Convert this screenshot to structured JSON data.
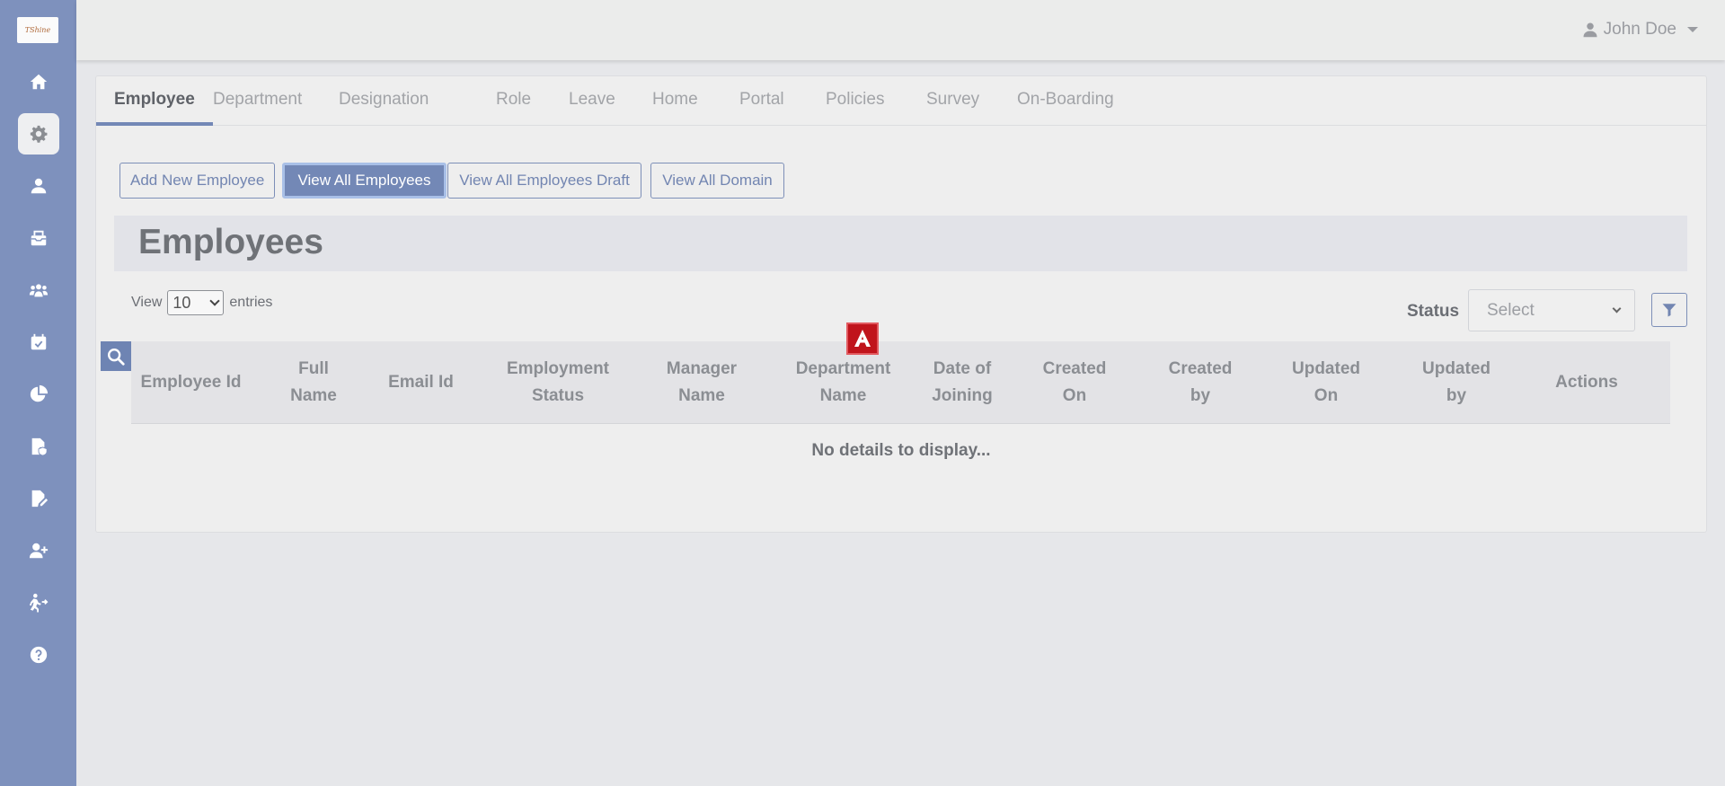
{
  "app": {
    "logo_text": "TShine"
  },
  "user": {
    "name": "John Doe"
  },
  "sidebar": {
    "items": [
      {
        "name": "home-icon"
      },
      {
        "name": "gear-icon",
        "active": true
      },
      {
        "name": "user-icon"
      },
      {
        "name": "inbox-icon"
      },
      {
        "name": "users-icon"
      },
      {
        "name": "calendar-check-icon"
      },
      {
        "name": "pie-chart-icon"
      },
      {
        "name": "file-shield-icon"
      },
      {
        "name": "file-edit-icon"
      },
      {
        "name": "user-plus-icon"
      },
      {
        "name": "exit-icon"
      },
      {
        "name": "help-icon"
      }
    ]
  },
  "tabs": [
    {
      "label": "Employee",
      "active": true
    },
    {
      "label": "Department"
    },
    {
      "label": "Designation"
    },
    {
      "label": "Role"
    },
    {
      "label": "Leave"
    },
    {
      "label": "Home"
    },
    {
      "label": "Portal"
    },
    {
      "label": "Policies"
    },
    {
      "label": "Survey"
    },
    {
      "label": "On-Boarding"
    }
  ],
  "actions": {
    "add_new": "Add New Employee",
    "view_all": "View All Employees",
    "view_draft": "View All Employees Draft",
    "view_domain": "View All Domain"
  },
  "page": {
    "title": "Employees"
  },
  "entries": {
    "prefix": "View",
    "value": "10",
    "suffix": "entries"
  },
  "status_filter": {
    "label": "Status",
    "placeholder": "Select"
  },
  "table": {
    "columns": [
      "Employee Id",
      "Full Name",
      "Email Id",
      "Employment Status",
      "Manager Name",
      "Department Name",
      "Date of Joining",
      "Created On",
      "Created by",
      "Updated On",
      "Updated by",
      "Actions"
    ],
    "empty_message": "No details to display..."
  },
  "colors": {
    "sidebar": "#7e91bd",
    "accent": "#7388b6",
    "badge_red": "#c0141c"
  }
}
